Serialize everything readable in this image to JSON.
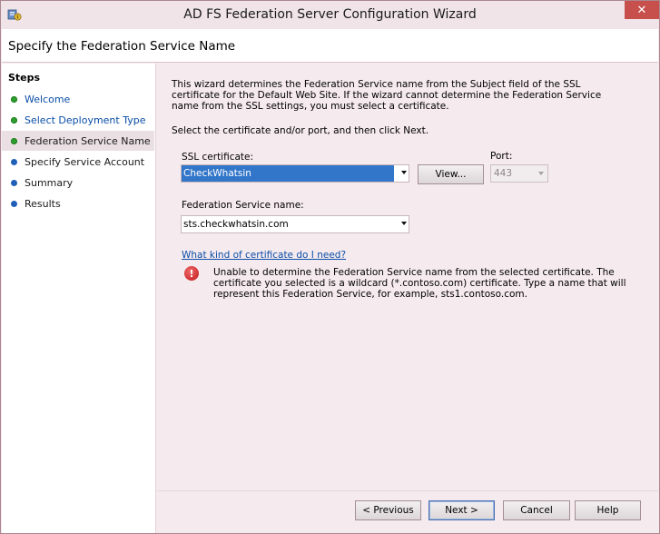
{
  "window": {
    "title": "AD FS Federation Server Configuration Wizard",
    "close_glyph": "✕",
    "icon": "adfs-wizard-icon"
  },
  "header": {
    "title": "Specify the Federation Service Name"
  },
  "steps": {
    "title": "Steps",
    "items": [
      {
        "label": "Welcome",
        "status": "complete",
        "dot_color": "#2e9e2e",
        "style": "link"
      },
      {
        "label": "Select Deployment Type",
        "status": "complete",
        "dot_color": "#2e9e2e",
        "style": "link"
      },
      {
        "label": "Federation Service Name",
        "status": "current",
        "dot_color": "#2e9e2e",
        "style": "plain"
      },
      {
        "label": "Specify Service Account",
        "status": "pending",
        "dot_color": "#1f5fb8",
        "style": "plain"
      },
      {
        "label": "Summary",
        "status": "pending",
        "dot_color": "#1f5fb8",
        "style": "plain"
      },
      {
        "label": "Results",
        "status": "pending",
        "dot_color": "#1f5fb8",
        "style": "plain"
      }
    ]
  },
  "content": {
    "intro": "This wizard determines the Federation Service name from the Subject field of the SSL certificate for the Default Web Site.  If the wizard cannot determine the Federation Service name from the SSL settings, you must select a certificate.",
    "instruction": "Select the certificate and/or port, and then click Next.",
    "ssl_label": "SSL certificate:",
    "ssl_value": "CheckWhatsin",
    "view_button": "View...",
    "port_label": "Port:",
    "port_value": "443",
    "fsn_label": "Federation Service name:",
    "fsn_value": "sts.checkwhatsin.com",
    "help_link": "What kind of certificate do I need?",
    "error_text": "Unable to determine the Federation Service name from the selected certificate. The certificate you selected is a wildcard (*.contoso.com) certificate. Type a name that will represent this Federation Service, for example, sts1.contoso.com.",
    "error_glyph": "!"
  },
  "footer": {
    "previous": "< Previous",
    "next": "Next >",
    "cancel": "Cancel",
    "help": "Help"
  },
  "colors": {
    "accent_link": "#0a4ea8",
    "selection": "#3276c9",
    "close_button": "#c7504c",
    "error": "#c01818"
  }
}
